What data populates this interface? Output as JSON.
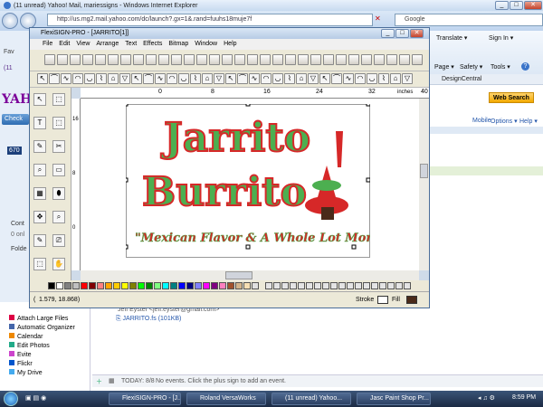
{
  "browser": {
    "window_title": "(11 unread) Yahoo! Mail, mariessigns - Windows Internet Explorer",
    "address": "http://us.mg2.mail.yahoo.com/dc/launch?.gx=1&.rand=fuuhs18muje7f",
    "search_placeholder": "Google",
    "cmd": {
      "translate": "Translate ▾",
      "signin": "Sign In ▾",
      "page": "Page ▾",
      "safety": "Safety ▾",
      "tools": "Tools ▾"
    }
  },
  "yahoo": {
    "logo_fragment": "YAH",
    "check_fragment": "Check",
    "search_button": "Web Search",
    "designcentral_tab": "DesignCentral",
    "links": {
      "mobile": "Mobile",
      "options": "Options ▾",
      "help": "Help ▾"
    },
    "fav": "Fav",
    "unread_fragment": "(11",
    "count": "670",
    "sidebar_fragments": [
      "Cont",
      "0 onl",
      "Folde"
    ],
    "apps": [
      "Attach Large Files",
      "Automatic Organizer",
      "Calendar",
      "Edit Photos",
      "Evite",
      "Flickr",
      "My Drive"
    ],
    "sender": "Jeff Eyster <jeff.eyster@gmail.com>",
    "attachment": "JARRITO.fs (101KB)",
    "today_prefix": "TODAY: 8/8",
    "today_text": "No events. Click the plus sign to add an event."
  },
  "flexisign": {
    "title": "FlexiSIGN-PRO - [JARRITO[1]]",
    "menu": [
      "File",
      "Edit",
      "View",
      "Arrange",
      "Text",
      "Effects",
      "Bitmap",
      "Window",
      "Help"
    ],
    "ruler_top": [
      "0",
      "8",
      "16",
      "24",
      "32",
      "40"
    ],
    "ruler_unit": "inches",
    "ruler_left": [
      "16",
      "8",
      "0"
    ],
    "design": {
      "line1": "Jarrito",
      "line2": "Burrito",
      "tagline": "\"Mexican Flavor & A Whole Lot More\"",
      "colors": {
        "green": "#4caf50",
        "red": "#d62828",
        "dark": "#4a2a1a"
      }
    },
    "status": {
      "coords": "1.579,     18.868)",
      "paren_open": "(",
      "stroke": "Stroke",
      "fill": "Fill"
    },
    "palette": [
      "#000000",
      "#ffffff",
      "#808080",
      "#c0c0c0",
      "#ff0000",
      "#800000",
      "#ff8080",
      "#ffa500",
      "#ffcc00",
      "#ffff00",
      "#808000",
      "#00ff00",
      "#008000",
      "#80ff80",
      "#00ffff",
      "#008080",
      "#0000ff",
      "#000080",
      "#8080ff",
      "#ff00ff",
      "#800080",
      "#ff80c0",
      "#a0522d",
      "#d2b48c",
      "#f5deb3",
      "#e0e0e0"
    ]
  },
  "taskbar": {
    "items": [
      "FlexiSIGN-PRO - [J...",
      "Roland VersaWorks",
      "(11 unread) Yahoo...",
      "Jasc Paint Shop Pr..."
    ],
    "clock": "8:59 PM"
  }
}
